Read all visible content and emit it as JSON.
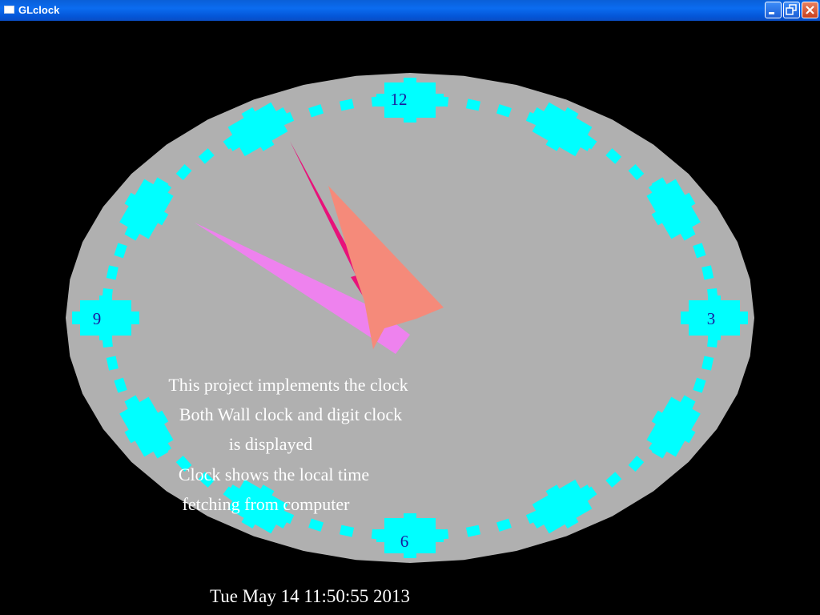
{
  "window": {
    "title": "GLclock",
    "buttons": [
      "minimize",
      "restore",
      "close"
    ]
  },
  "clock": {
    "numerals": {
      "twelve": "12",
      "three": "3",
      "six": "6",
      "nine": "9"
    },
    "time": {
      "hour": 11,
      "minute": 50,
      "second": 55
    }
  },
  "info_lines": [
    "This project implements the clock",
    "Both Wall clock and digit clock",
    "is displayed",
    "Clock shows the local time",
    "fetching from computer"
  ],
  "datetime": "Tue May 14 11:50:55 2013",
  "colors": {
    "background": "#000000",
    "face": "#b0b0b0",
    "markers": "#00ffff",
    "numerals": "#1a1a9e",
    "hour_hand": "#f58a7a",
    "minute_hand": "#ee82ee",
    "second_hand": "#e8127a",
    "text": "#ffffff"
  },
  "icons": {
    "window_icon": "window-icon",
    "minimize": "minimize-icon",
    "restore": "restore-icon",
    "close": "close-icon"
  }
}
